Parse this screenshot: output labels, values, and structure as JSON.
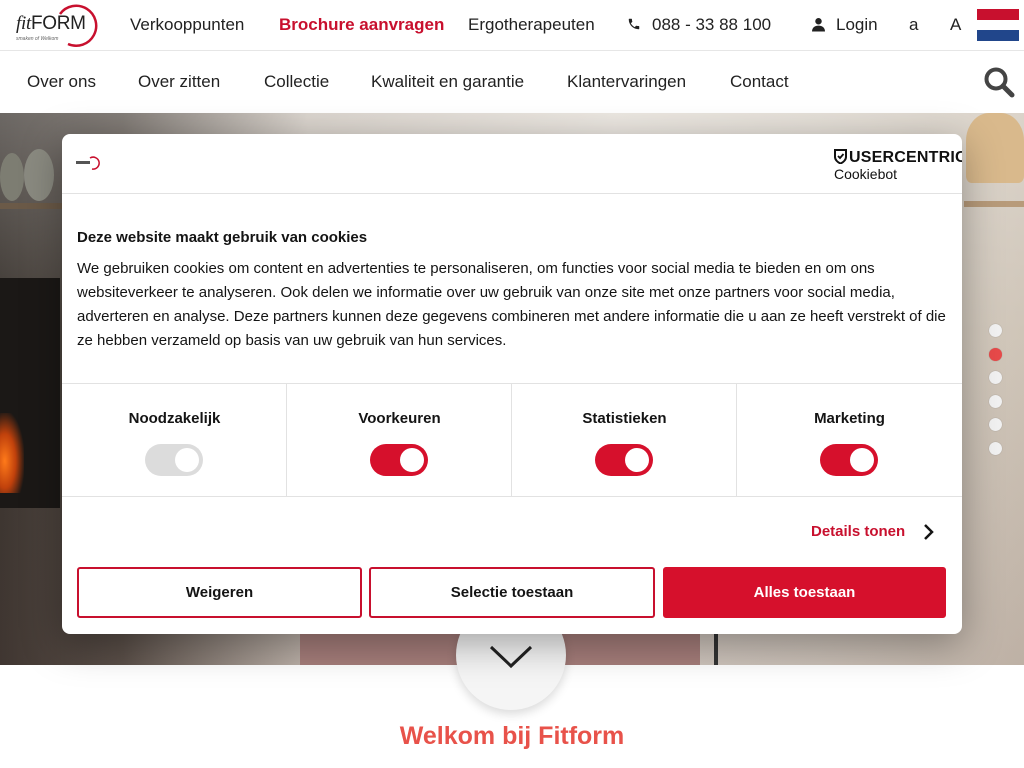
{
  "brand": {
    "logo_text_fit": "fit",
    "logo_text_form": "FORM",
    "logo_tagline": "smaken of Welkom",
    "accent_color": "#c8102e"
  },
  "topnav": {
    "items": [
      "Verkooppunten",
      "Brochure aanvragen",
      "Ergotherapeuten"
    ],
    "phone": "088 - 33 88 100",
    "login": "Login",
    "font_small": "a",
    "font_large": "A",
    "language_flag": "dutch-flag"
  },
  "mainnav": {
    "items": [
      "Over ons",
      "Over zitten",
      "Collectie",
      "Kwaliteit en garantie",
      "Klantervaringen",
      "Contact"
    ]
  },
  "hero": {
    "slide_count": 6,
    "active_slide": 2
  },
  "welcome": "Welkom bij Fitform",
  "cookie": {
    "provider_brand": "USERCENTRICS",
    "provider_sub": "Cookiebot",
    "title": "Deze website maakt gebruik van cookies",
    "body": "We gebruiken cookies om content en advertenties te personaliseren, om functies voor social media te bieden en om ons websiteverkeer te analyseren. Ook delen we informatie over uw gebruik van onze site met onze partners voor social media, adverteren en analyse. Deze partners kunnen deze gegevens combineren met andere informatie die u aan ze heeft verstrekt of die ze hebben verzameld op basis van uw gebruik van hun services.",
    "categories": [
      {
        "label": "Noodzakelijk",
        "enabled": true,
        "locked": true
      },
      {
        "label": "Voorkeuren",
        "enabled": true,
        "locked": false
      },
      {
        "label": "Statistieken",
        "enabled": true,
        "locked": false
      },
      {
        "label": "Marketing",
        "enabled": true,
        "locked": false
      }
    ],
    "details_label": "Details tonen",
    "buttons": {
      "deny": "Weigeren",
      "selection": "Selectie toestaan",
      "allow_all": "Alles toestaan"
    }
  }
}
